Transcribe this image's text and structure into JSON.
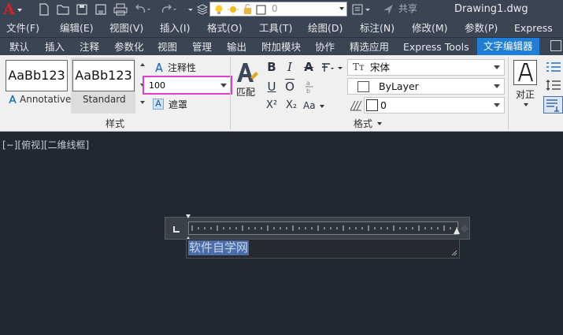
{
  "app": {
    "logo_letter": "A",
    "document_title": "Drawing1.dwg",
    "share_label": "共享",
    "layer_combo_value": "0"
  },
  "menubar": {
    "items": [
      "文件(F)",
      "编辑(E)",
      "视图(V)",
      "插入(I)",
      "格式(O)",
      "工具(T)",
      "绘图(D)",
      "标注(N)",
      "修改(M)",
      "参数(P)",
      "Express"
    ]
  },
  "tabs": {
    "items": [
      "默认",
      "插入",
      "注释",
      "参数化",
      "视图",
      "管理",
      "输出",
      "附加模块",
      "协作",
      "精选应用",
      "Express Tools",
      "文字编辑器"
    ],
    "active": "文字编辑器"
  },
  "style_panel": {
    "sample_text": "AaBb123",
    "style_names": [
      "Annotative",
      "Standard"
    ],
    "annotative_label": "注释性",
    "text_height_value": "100",
    "mask_label": "遮罩",
    "panel_title": "样式"
  },
  "format_panel": {
    "match_label": "匹配",
    "font_value": "宋体",
    "font_prefix": "Tт",
    "color_value": "ByLayer",
    "oblique_value": "0",
    "superscript_label": "X²",
    "subscript_label": "X₂",
    "case_label": "Aa",
    "panel_title": "格式"
  },
  "paragraph_panel": {
    "justify_label": "对正"
  },
  "canvas": {
    "view_label": "[−][俯视][二维线框]",
    "editor_text": "软件自学网"
  },
  "colors": {
    "accent_tab": "#1f7fd6",
    "highlight_box": "#e33bd6",
    "canvas_bg": "#212830",
    "logo_red": "#d8222a"
  }
}
